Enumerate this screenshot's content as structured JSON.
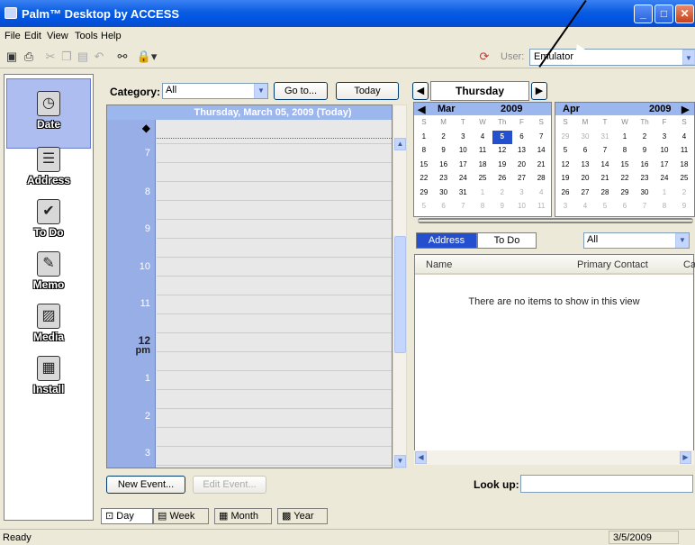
{
  "window": {
    "title": "Palm™ Desktop by ACCESS"
  },
  "menu": [
    "File",
    "Edit",
    "View",
    "Tools",
    "Help"
  ],
  "toolbar": {
    "user_label": "User:",
    "user_value": "Emulator"
  },
  "sidebar": [
    "Date",
    "Address",
    "To Do",
    "Memo",
    "Media",
    "Install"
  ],
  "dayview": {
    "category_label": "Category:",
    "category_value": "All",
    "goto": "Go to...",
    "today": "Today",
    "header": "Thursday, March 05, 2009 (Today)",
    "hours": [
      "7",
      "8",
      "9",
      "10",
      "11",
      "12",
      "3"
    ],
    "hour12_sub": "pm",
    "hours_pm": [
      "1",
      "2",
      "3"
    ],
    "new_event": "New Event...",
    "edit_event": "Edit Event..."
  },
  "daynav": {
    "day": "Thursday"
  },
  "cal_mar": {
    "month": "Mar",
    "year": "2009",
    "dow": [
      "S",
      "M",
      "T",
      "W",
      "Th",
      "F",
      "S"
    ],
    "weeks": [
      [
        "1",
        "2",
        "3",
        "4",
        "5",
        "6",
        "7"
      ],
      [
        "8",
        "9",
        "10",
        "11",
        "12",
        "13",
        "14"
      ],
      [
        "15",
        "16",
        "17",
        "18",
        "19",
        "20",
        "21"
      ],
      [
        "22",
        "23",
        "24",
        "25",
        "26",
        "27",
        "28"
      ],
      [
        "29",
        "30",
        "31",
        "1",
        "2",
        "3",
        "4"
      ],
      [
        "5",
        "6",
        "7",
        "8",
        "9",
        "10",
        "11"
      ]
    ]
  },
  "cal_apr": {
    "month": "Apr",
    "year": "2009",
    "dow": [
      "S",
      "M",
      "T",
      "W",
      "Th",
      "F",
      "S"
    ],
    "weeks": [
      [
        "29",
        "30",
        "31",
        "1",
        "2",
        "3",
        "4"
      ],
      [
        "5",
        "6",
        "7",
        "8",
        "9",
        "10",
        "11"
      ],
      [
        "12",
        "13",
        "14",
        "15",
        "16",
        "17",
        "18"
      ],
      [
        "19",
        "20",
        "21",
        "22",
        "23",
        "24",
        "25"
      ],
      [
        "26",
        "27",
        "28",
        "29",
        "30",
        "1",
        "2"
      ],
      [
        "3",
        "4",
        "5",
        "6",
        "7",
        "8",
        "9"
      ]
    ]
  },
  "list": {
    "tab_address": "Address",
    "tab_todo": "To Do",
    "filter": "All",
    "col_name": "Name",
    "col_contact": "Primary Contact",
    "col_cat": "Cat",
    "empty": "There are no items to show in this view",
    "lookup": "Look up:"
  },
  "viewtabs": [
    "Day",
    "Week",
    "Month",
    "Year"
  ],
  "status": {
    "left": "Ready",
    "date": "3/5/2009"
  }
}
